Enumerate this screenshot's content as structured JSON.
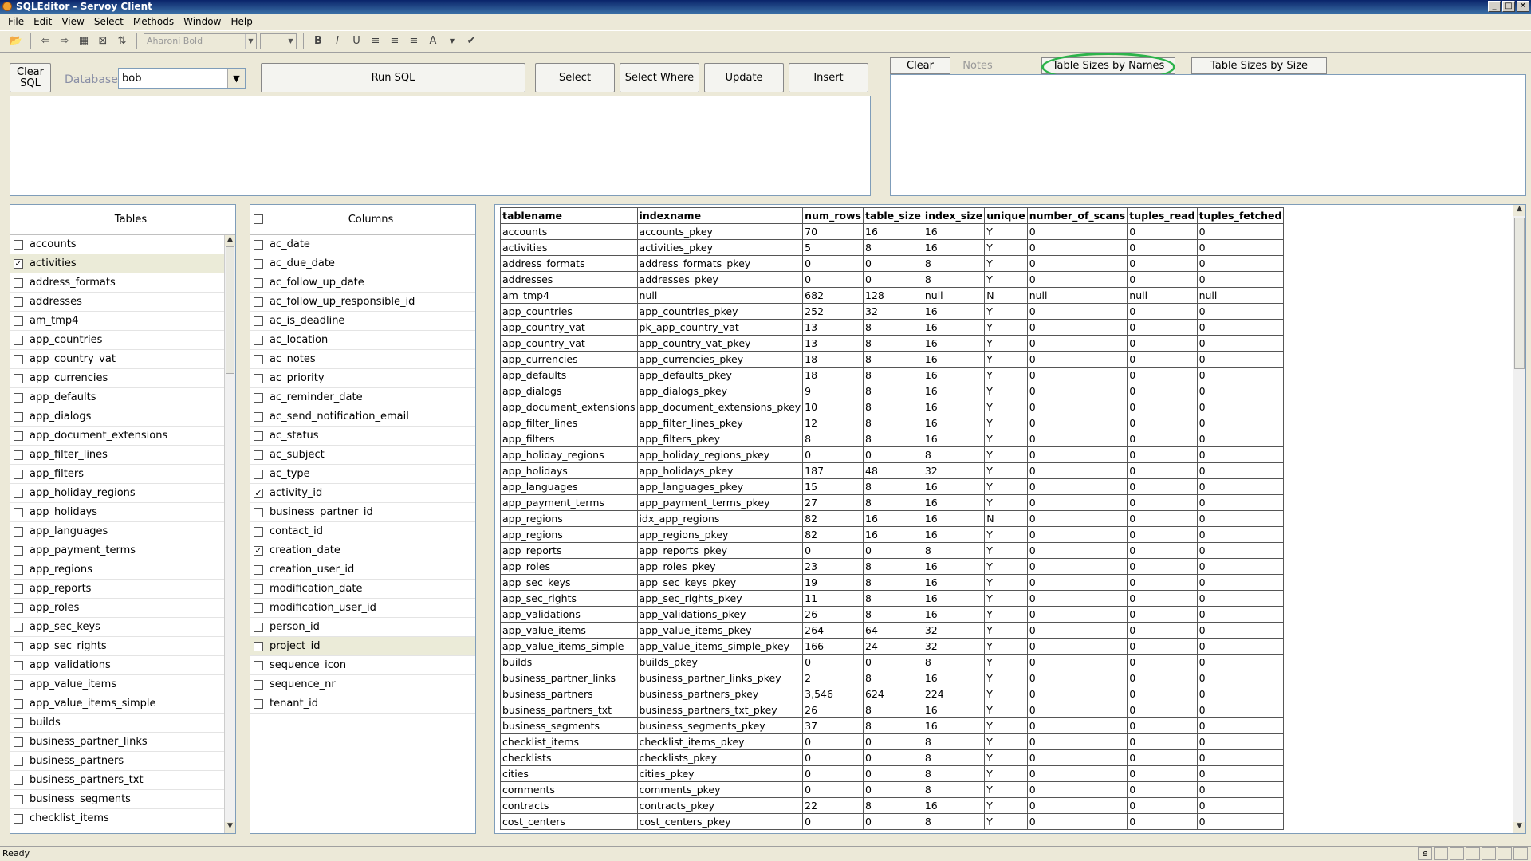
{
  "window": {
    "title": "SQLEditor - Servoy Client"
  },
  "menu": [
    "File",
    "Edit",
    "View",
    "Select",
    "Methods",
    "Window",
    "Help"
  ],
  "toolbar": {
    "font_name": "Aharoni Bold",
    "font_size": ""
  },
  "controls": {
    "clear_sql": "Clear SQL",
    "database_label": "Database:",
    "database_value": "bob",
    "run_sql": "Run SQL",
    "select": "Select",
    "select_where": "Select Where",
    "update": "Update",
    "insert": "Insert"
  },
  "tabs": {
    "clear": "Clear",
    "notes": "Notes",
    "table_sizes_by_names": "Table Sizes by Names",
    "table_sizes_by_size": "Table Sizes by Size"
  },
  "tables_panel": {
    "header": "Tables",
    "items": [
      {
        "name": "accounts",
        "checked": false
      },
      {
        "name": "activities",
        "checked": true,
        "selected": true
      },
      {
        "name": "address_formats",
        "checked": false
      },
      {
        "name": "addresses",
        "checked": false
      },
      {
        "name": "am_tmp4",
        "checked": false
      },
      {
        "name": "app_countries",
        "checked": false
      },
      {
        "name": "app_country_vat",
        "checked": false
      },
      {
        "name": "app_currencies",
        "checked": false
      },
      {
        "name": "app_defaults",
        "checked": false
      },
      {
        "name": "app_dialogs",
        "checked": false
      },
      {
        "name": "app_document_extensions",
        "checked": false
      },
      {
        "name": "app_filter_lines",
        "checked": false
      },
      {
        "name": "app_filters",
        "checked": false
      },
      {
        "name": "app_holiday_regions",
        "checked": false
      },
      {
        "name": "app_holidays",
        "checked": false
      },
      {
        "name": "app_languages",
        "checked": false
      },
      {
        "name": "app_payment_terms",
        "checked": false
      },
      {
        "name": "app_regions",
        "checked": false
      },
      {
        "name": "app_reports",
        "checked": false
      },
      {
        "name": "app_roles",
        "checked": false
      },
      {
        "name": "app_sec_keys",
        "checked": false
      },
      {
        "name": "app_sec_rights",
        "checked": false
      },
      {
        "name": "app_validations",
        "checked": false
      },
      {
        "name": "app_value_items",
        "checked": false
      },
      {
        "name": "app_value_items_simple",
        "checked": false
      },
      {
        "name": "builds",
        "checked": false
      },
      {
        "name": "business_partner_links",
        "checked": false
      },
      {
        "name": "business_partners",
        "checked": false
      },
      {
        "name": "business_partners_txt",
        "checked": false
      },
      {
        "name": "business_segments",
        "checked": false
      },
      {
        "name": "checklist_items",
        "checked": false
      }
    ]
  },
  "columns_panel": {
    "header": "Columns",
    "items": [
      {
        "name": "ac_date",
        "checked": false
      },
      {
        "name": "ac_due_date",
        "checked": false
      },
      {
        "name": "ac_follow_up_date",
        "checked": false
      },
      {
        "name": "ac_follow_up_responsible_id",
        "checked": false
      },
      {
        "name": "ac_is_deadline",
        "checked": false
      },
      {
        "name": "ac_location",
        "checked": false
      },
      {
        "name": "ac_notes",
        "checked": false
      },
      {
        "name": "ac_priority",
        "checked": false
      },
      {
        "name": "ac_reminder_date",
        "checked": false
      },
      {
        "name": "ac_send_notification_email",
        "checked": false
      },
      {
        "name": "ac_status",
        "checked": false
      },
      {
        "name": "ac_subject",
        "checked": false
      },
      {
        "name": "ac_type",
        "checked": false
      },
      {
        "name": "activity_id",
        "checked": true
      },
      {
        "name": "business_partner_id",
        "checked": false
      },
      {
        "name": "contact_id",
        "checked": false
      },
      {
        "name": "creation_date",
        "checked": true
      },
      {
        "name": "creation_user_id",
        "checked": false
      },
      {
        "name": "modification_date",
        "checked": false
      },
      {
        "name": "modification_user_id",
        "checked": false
      },
      {
        "name": "person_id",
        "checked": false
      },
      {
        "name": "project_id",
        "checked": false,
        "selected": true
      },
      {
        "name": "sequence_icon",
        "checked": false
      },
      {
        "name": "sequence_nr",
        "checked": false
      },
      {
        "name": "tenant_id",
        "checked": false
      }
    ]
  },
  "results": {
    "headers": [
      "tablename",
      "indexname",
      "num_rows",
      "table_size",
      "index_size",
      "unique",
      "number_of_scans",
      "tuples_read",
      "tuples_fetched"
    ],
    "rows": [
      [
        "accounts",
        "accounts_pkey",
        "70",
        "16",
        "16",
        "Y",
        "0",
        "0",
        "0"
      ],
      [
        "activities",
        "activities_pkey",
        "5",
        "8",
        "16",
        "Y",
        "0",
        "0",
        "0"
      ],
      [
        "address_formats",
        "address_formats_pkey",
        "0",
        "0",
        "8",
        "Y",
        "0",
        "0",
        "0"
      ],
      [
        "addresses",
        "addresses_pkey",
        "0",
        "0",
        "8",
        "Y",
        "0",
        "0",
        "0"
      ],
      [
        "am_tmp4",
        "null",
        "682",
        "128",
        "null",
        "N",
        "null",
        "null",
        "null"
      ],
      [
        "app_countries",
        "app_countries_pkey",
        "252",
        "32",
        "16",
        "Y",
        "0",
        "0",
        "0"
      ],
      [
        "app_country_vat",
        "pk_app_country_vat",
        "13",
        "8",
        "16",
        "Y",
        "0",
        "0",
        "0"
      ],
      [
        "app_country_vat",
        "app_country_vat_pkey",
        "13",
        "8",
        "16",
        "Y",
        "0",
        "0",
        "0"
      ],
      [
        "app_currencies",
        "app_currencies_pkey",
        "18",
        "8",
        "16",
        "Y",
        "0",
        "0",
        "0"
      ],
      [
        "app_defaults",
        "app_defaults_pkey",
        "18",
        "8",
        "16",
        "Y",
        "0",
        "0",
        "0"
      ],
      [
        "app_dialogs",
        "app_dialogs_pkey",
        "9",
        "8",
        "16",
        "Y",
        "0",
        "0",
        "0"
      ],
      [
        "app_document_extensions",
        "app_document_extensions_pkey",
        "10",
        "8",
        "16",
        "Y",
        "0",
        "0",
        "0"
      ],
      [
        "app_filter_lines",
        "app_filter_lines_pkey",
        "12",
        "8",
        "16",
        "Y",
        "0",
        "0",
        "0"
      ],
      [
        "app_filters",
        "app_filters_pkey",
        "8",
        "8",
        "16",
        "Y",
        "0",
        "0",
        "0"
      ],
      [
        "app_holiday_regions",
        "app_holiday_regions_pkey",
        "0",
        "0",
        "8",
        "Y",
        "0",
        "0",
        "0"
      ],
      [
        "app_holidays",
        "app_holidays_pkey",
        "187",
        "48",
        "32",
        "Y",
        "0",
        "0",
        "0"
      ],
      [
        "app_languages",
        "app_languages_pkey",
        "15",
        "8",
        "16",
        "Y",
        "0",
        "0",
        "0"
      ],
      [
        "app_payment_terms",
        "app_payment_terms_pkey",
        "27",
        "8",
        "16",
        "Y",
        "0",
        "0",
        "0"
      ],
      [
        "app_regions",
        "idx_app_regions",
        "82",
        "16",
        "16",
        "N",
        "0",
        "0",
        "0"
      ],
      [
        "app_regions",
        "app_regions_pkey",
        "82",
        "16",
        "16",
        "Y",
        "0",
        "0",
        "0"
      ],
      [
        "app_reports",
        "app_reports_pkey",
        "0",
        "0",
        "8",
        "Y",
        "0",
        "0",
        "0"
      ],
      [
        "app_roles",
        "app_roles_pkey",
        "23",
        "8",
        "16",
        "Y",
        "0",
        "0",
        "0"
      ],
      [
        "app_sec_keys",
        "app_sec_keys_pkey",
        "19",
        "8",
        "16",
        "Y",
        "0",
        "0",
        "0"
      ],
      [
        "app_sec_rights",
        "app_sec_rights_pkey",
        "11",
        "8",
        "16",
        "Y",
        "0",
        "0",
        "0"
      ],
      [
        "app_validations",
        "app_validations_pkey",
        "26",
        "8",
        "16",
        "Y",
        "0",
        "0",
        "0"
      ],
      [
        "app_value_items",
        "app_value_items_pkey",
        "264",
        "64",
        "32",
        "Y",
        "0",
        "0",
        "0"
      ],
      [
        "app_value_items_simple",
        "app_value_items_simple_pkey",
        "166",
        "24",
        "32",
        "Y",
        "0",
        "0",
        "0"
      ],
      [
        "builds",
        "builds_pkey",
        "0",
        "0",
        "8",
        "Y",
        "0",
        "0",
        "0"
      ],
      [
        "business_partner_links",
        "business_partner_links_pkey",
        "2",
        "8",
        "16",
        "Y",
        "0",
        "0",
        "0"
      ],
      [
        "business_partners",
        "business_partners_pkey",
        "3,546",
        "624",
        "224",
        "Y",
        "0",
        "0",
        "0"
      ],
      [
        "business_partners_txt",
        "business_partners_txt_pkey",
        "26",
        "8",
        "16",
        "Y",
        "0",
        "0",
        "0"
      ],
      [
        "business_segments",
        "business_segments_pkey",
        "37",
        "8",
        "16",
        "Y",
        "0",
        "0",
        "0"
      ],
      [
        "checklist_items",
        "checklist_items_pkey",
        "0",
        "0",
        "8",
        "Y",
        "0",
        "0",
        "0"
      ],
      [
        "checklists",
        "checklists_pkey",
        "0",
        "0",
        "8",
        "Y",
        "0",
        "0",
        "0"
      ],
      [
        "cities",
        "cities_pkey",
        "0",
        "0",
        "8",
        "Y",
        "0",
        "0",
        "0"
      ],
      [
        "comments",
        "comments_pkey",
        "0",
        "0",
        "8",
        "Y",
        "0",
        "0",
        "0"
      ],
      [
        "contracts",
        "contracts_pkey",
        "22",
        "8",
        "16",
        "Y",
        "0",
        "0",
        "0"
      ],
      [
        "cost_centers",
        "cost_centers_pkey",
        "0",
        "0",
        "8",
        "Y",
        "0",
        "0",
        "0"
      ]
    ]
  },
  "status": {
    "text": "Ready"
  }
}
